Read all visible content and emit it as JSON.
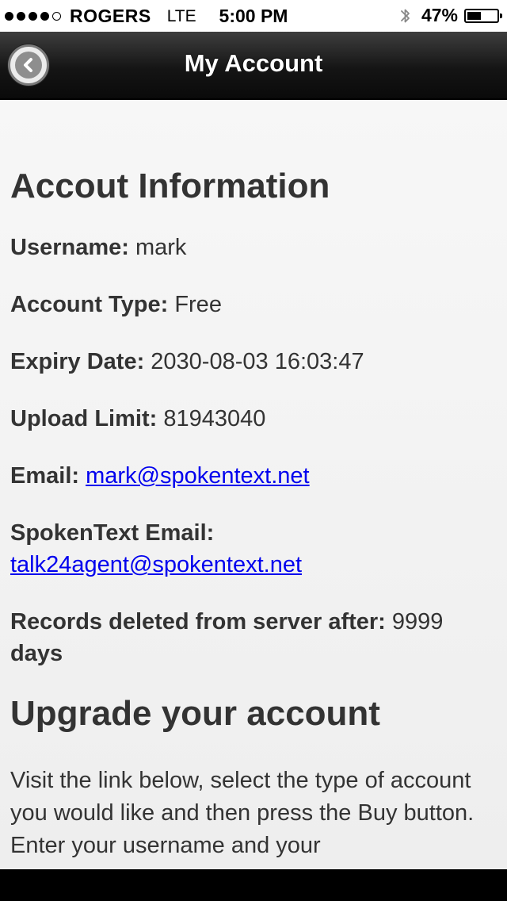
{
  "status_bar": {
    "carrier": "ROGERS",
    "network": "LTE",
    "time": "5:00 PM",
    "battery_percent": "47%",
    "battery_level": 0.47,
    "signal_bars_filled": 4,
    "signal_bars_total": 5
  },
  "nav": {
    "title": "My Account",
    "back_icon": "back-arrow-icon"
  },
  "account": {
    "heading": "Accout Information",
    "username_label": "Username:",
    "username_value": "mark",
    "account_type_label": "Account Type:",
    "account_type_value": "Free",
    "expiry_label": "Expiry Date:",
    "expiry_value": "2030-08-03 16:03:47",
    "upload_limit_label": "Upload Limit:",
    "upload_limit_value": "81943040",
    "email_label": "Email:",
    "email_value": "mark@spokentext.net",
    "spokentext_email_label": "SpokenText Email:",
    "spokentext_email_value": "talk24agent@spokentext.net",
    "records_label": "Records deleted from server after:",
    "records_value": "9999",
    "records_unit": "days"
  },
  "upgrade": {
    "heading": "Upgrade your account",
    "text": "Visit the link below, select the type of account you would like and then press the Buy button. Enter your username and your"
  },
  "colors": {
    "link": "#0000ee",
    "text": "#333333",
    "nav_bg": "#151515"
  }
}
